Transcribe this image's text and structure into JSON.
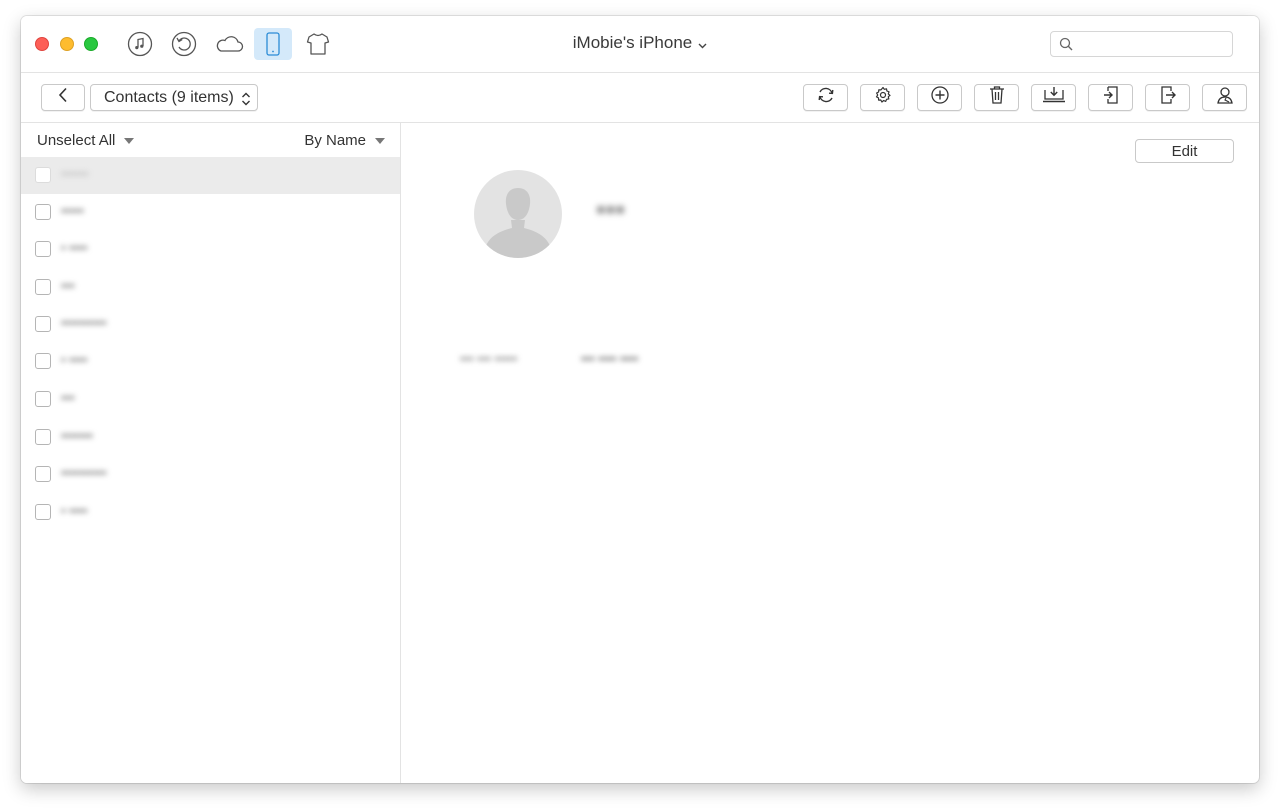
{
  "window": {
    "title": "iMobie's iPhone",
    "traffic_colors": {
      "close": "#fd5f57",
      "minimize": "#febc2e",
      "maximize": "#29c840"
    }
  },
  "mode_icons": [
    "itunes-icon",
    "backup-restore-icon",
    "icloud-icon",
    "iphone-icon",
    "tshirt-icon"
  ],
  "active_mode": "iphone-icon",
  "search": {
    "placeholder": ""
  },
  "toolbar": {
    "category_label": "Contacts (9 items)",
    "tools": [
      "refresh-icon",
      "settings-icon",
      "add-icon",
      "delete-icon",
      "download-to-computer-icon",
      "import-icon",
      "export-icon",
      "contact-icon"
    ]
  },
  "list": {
    "unselect_label": "Unselect All",
    "sort_label": "By Name",
    "contacts": [
      {
        "name": "••••••",
        "selected": true
      },
      {
        "name": "•••••"
      },
      {
        "name": "• ••••"
      },
      {
        "name": "•••"
      },
      {
        "name": "••••••••••"
      },
      {
        "name": "• ••••"
      },
      {
        "name": "•••"
      },
      {
        "name": "•••••••"
      },
      {
        "name": "••••••••••"
      },
      {
        "name": "• ••••"
      }
    ]
  },
  "detail": {
    "edit_label": "Edit",
    "name": "•••",
    "phone_label": "••• ••• •••••",
    "phone_value": "••• •••• ••••"
  }
}
